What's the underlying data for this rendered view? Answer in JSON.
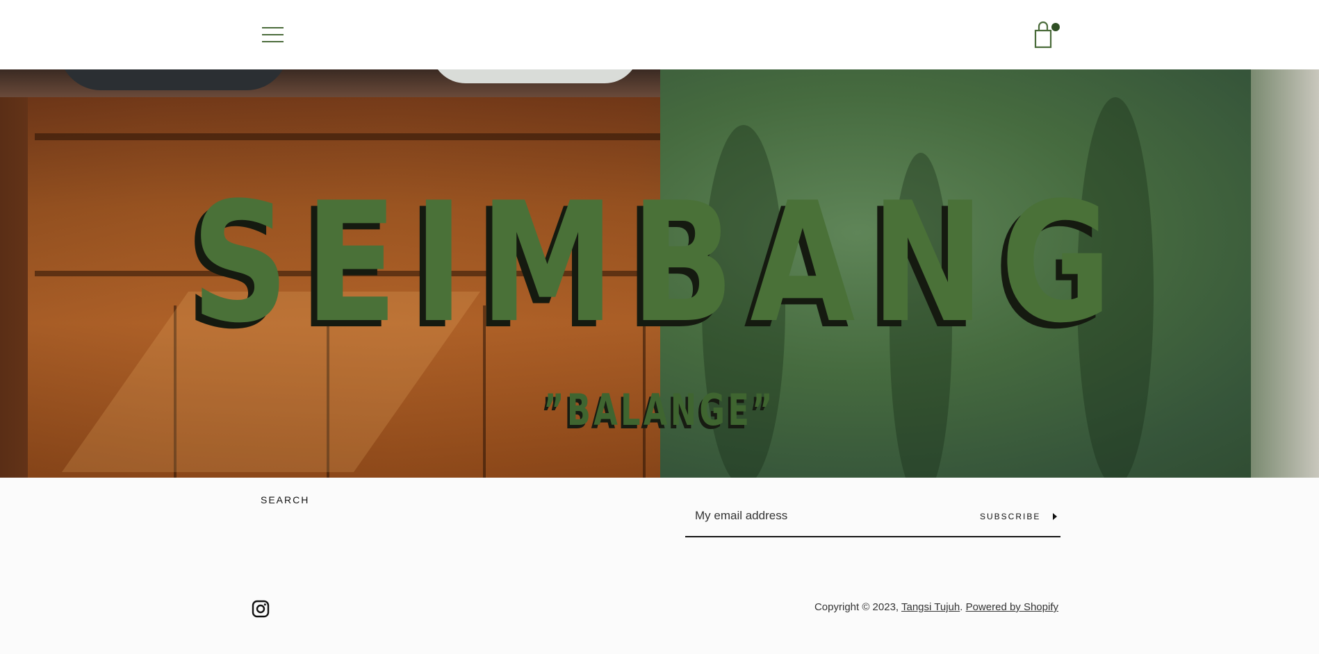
{
  "header": {
    "menu_icon": "hamburger-menu-icon",
    "cart_icon": "shopping-bag-icon",
    "accent_color": "#4a6b3a"
  },
  "hero": {
    "title": "SEIMBANG",
    "subtitle": "”BALANGE”",
    "title_color": "#4a7138"
  },
  "footer": {
    "search_label": "SEARCH",
    "newsletter": {
      "placeholder": "My email address",
      "subscribe_label": "SUBSCRIBE"
    },
    "social_icon": "instagram-icon",
    "copyright_prefix": "Copyright © 2023,",
    "store_link": "Tangsi Tujuh",
    "separator": ".",
    "powered_link": "Powered by Shopify"
  }
}
